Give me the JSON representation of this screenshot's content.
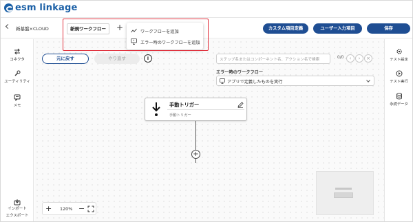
{
  "brand": {
    "name": "esm linkage"
  },
  "toolbar": {
    "breadcrumb": "新基盤×CLOUD",
    "active_tab": "新規ワークフロー",
    "add_tab_symbol": "+",
    "custom_fields_label": "カスタム項目定義",
    "user_input_label": "ユーザー入力項目",
    "save_label": "保存"
  },
  "add_menu": {
    "items": [
      {
        "label": "ワークフローを追加",
        "icon": "workflow-line-icon"
      },
      {
        "label": "エラー時のワークフローを追加",
        "icon": "error-workflow-icon"
      }
    ]
  },
  "left_sidebar": {
    "items": [
      {
        "label": "コネクタ",
        "icon": "connector-arrows-icon"
      },
      {
        "label": "ユーティリティ",
        "icon": "wrench-icon"
      },
      {
        "label": "メモ",
        "icon": "memo-icon"
      }
    ],
    "import_export": {
      "line1": "インポート",
      "line2": "エクスポート",
      "icon": "import-export-icon"
    }
  },
  "right_sidebar": {
    "items": [
      {
        "label": "テスト設定",
        "icon": "gear-icon"
      },
      {
        "label": "テスト実行",
        "icon": "play-icon"
      },
      {
        "label": "永続データ",
        "icon": "database-icon"
      }
    ]
  },
  "canvas": {
    "undo_label": "元に戻す",
    "redo_label": "やり直す",
    "info_symbol": "i",
    "search_placeholder": "ステップ名またはコンポーネント名、アクション名で検索",
    "search_count": "0/0",
    "error_workflow_label": "エラー時のワークフロー",
    "error_workflow_value": "アプリで定義したものを実行"
  },
  "trigger_node": {
    "title": "手動トリガー",
    "subtitle": "手動トリガー",
    "icon": "down-arrow-trigger-icon"
  },
  "zoom": {
    "value": "120%",
    "plus": "+",
    "minus": "−"
  },
  "colors": {
    "brand": "#1a5fa6",
    "primary": "#1f4e93",
    "highlight": "#e0303c"
  }
}
